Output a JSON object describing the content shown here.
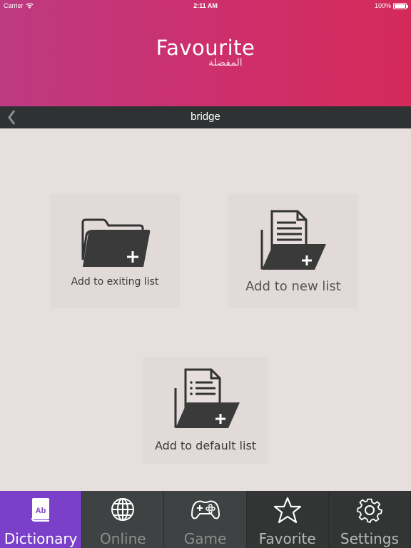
{
  "status_bar": {
    "carrier": "Carrier",
    "time": "2:11 AM",
    "battery": "100%"
  },
  "header": {
    "title": "Favourite",
    "subtitle": "المفضلة"
  },
  "nav": {
    "word": "bridge"
  },
  "actions": {
    "existing_label": "Add to exiting list",
    "new_label": "Add to new list",
    "default_label": "Add to default list"
  },
  "tabs": [
    {
      "label": "Dictionary",
      "icon": "dictionary-book-icon"
    },
    {
      "label": "Online",
      "icon": "globe-icon"
    },
    {
      "label": "Game",
      "icon": "gamepad-icon"
    },
    {
      "label": "Favorite",
      "icon": "star-icon"
    },
    {
      "label": "Settings",
      "icon": "gear-icon"
    }
  ],
  "colors": {
    "header_start": "#bd3a82",
    "header_end": "#d42a5a",
    "nav_bg": "#2f3232",
    "tab_active": "#7b40c9",
    "content_bg": "#e6dfde"
  }
}
